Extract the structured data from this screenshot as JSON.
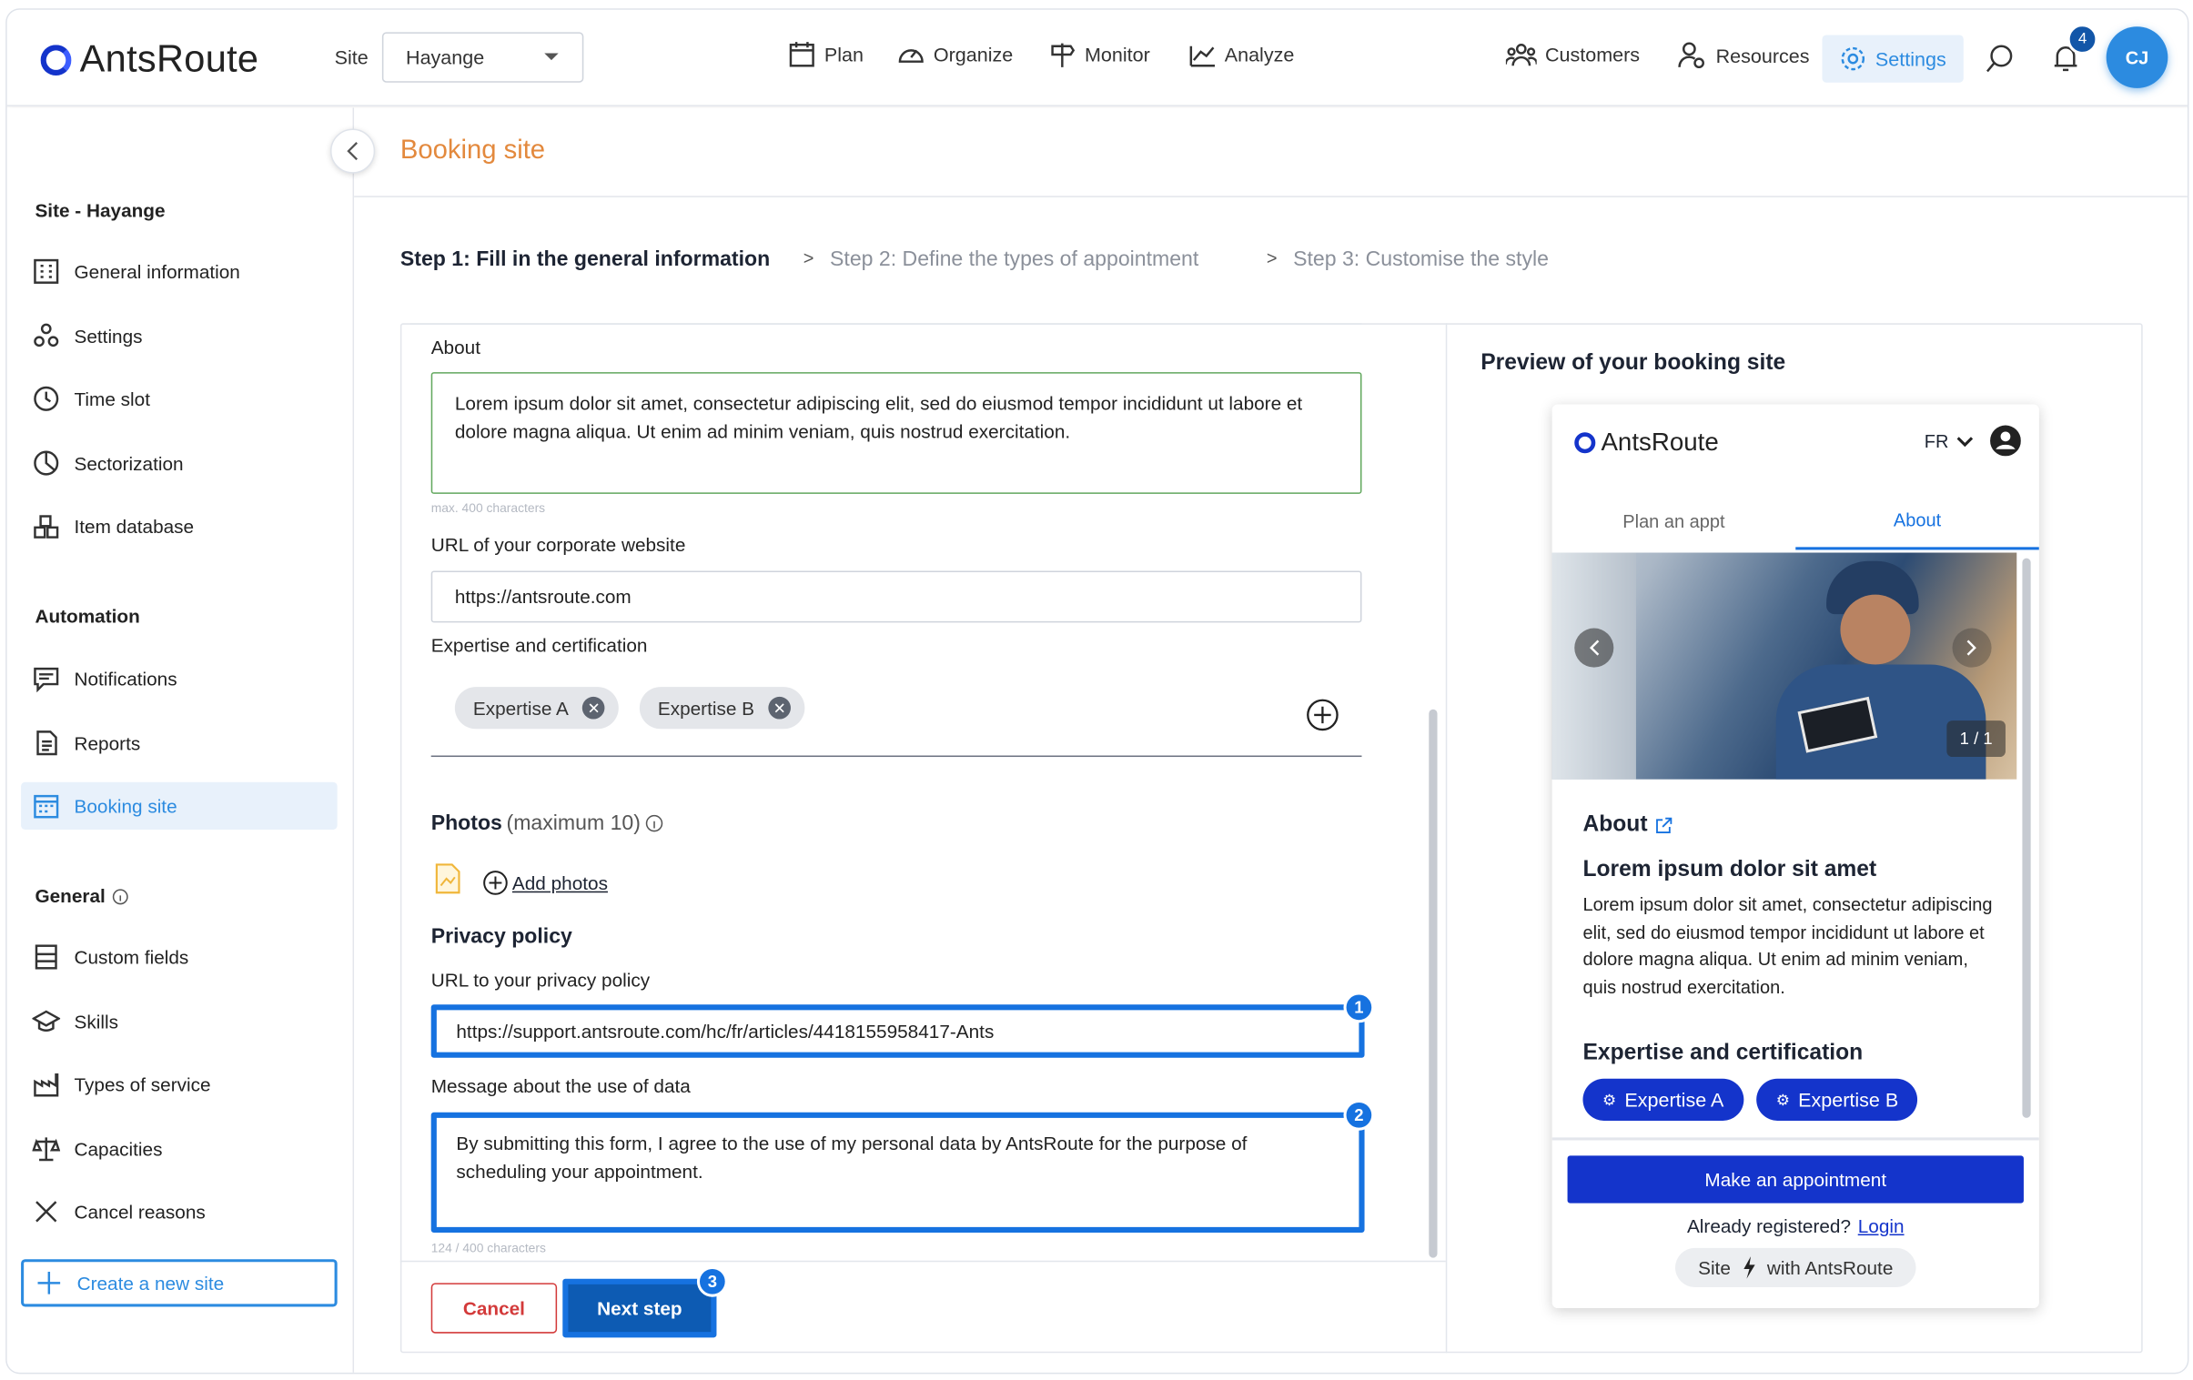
{
  "header": {
    "logo_text": "AntsRoute",
    "site_label": "Site",
    "site_value": "Hayange",
    "nav": [
      {
        "label": "Plan"
      },
      {
        "label": "Organize"
      },
      {
        "label": "Monitor"
      },
      {
        "label": "Analyze"
      }
    ],
    "right_nav": [
      {
        "label": "Customers"
      },
      {
        "label": "Resources"
      },
      {
        "label": "Settings"
      }
    ],
    "notification_count": "4",
    "avatar_initials": "CJ",
    "accent_color": "#1434cb",
    "active_color": "#2c8be0"
  },
  "sidebar": {
    "site_section": "Site - Hayange",
    "site_items": [
      {
        "label": "General information"
      },
      {
        "label": "Settings"
      },
      {
        "label": "Time slot"
      },
      {
        "label": "Sectorization"
      },
      {
        "label": "Item database"
      }
    ],
    "automation_section": "Automation",
    "automation_items": [
      {
        "label": "Notifications"
      },
      {
        "label": "Reports"
      },
      {
        "label": "Booking site"
      }
    ],
    "general_section": "General",
    "general_items": [
      {
        "label": "Custom fields"
      },
      {
        "label": "Skills"
      },
      {
        "label": "Types of service"
      },
      {
        "label": "Capacities"
      },
      {
        "label": "Cancel reasons"
      }
    ],
    "create_site": "Create a new site"
  },
  "page": {
    "title": "Booking site",
    "steps": {
      "step1": "Step 1: Fill in the general information",
      "sep": ">",
      "step2": "Step 2: Define the types of appointment",
      "step3": "Step 3: Customise the style"
    }
  },
  "form": {
    "about_label": "About",
    "about_value": "Lorem ipsum dolor sit amet, consectetur adipiscing elit, sed do eiusmod tempor incididunt ut labore et dolore magna aliqua. Ut enim ad minim veniam, quis nostrud exercitation.",
    "about_hint": "max. 400 characters",
    "website_label": "URL of your corporate website",
    "website_value": "https://antsroute.com",
    "expertise_label": "Expertise and certification",
    "expertise_chips": [
      "Expertise A",
      "Expertise B"
    ],
    "photos_label": "Photos",
    "photos_hint": "(maximum 10)",
    "add_photos": "Add photos",
    "privacy_heading": "Privacy policy",
    "privacy_url_label": "URL to your privacy policy",
    "privacy_url_value": "https://support.antsroute.com/hc/fr/articles/4418155958417-Ants",
    "data_msg_label": "Message about the use of data",
    "data_msg_value": "By submitting this form, I agree to the use of my personal data by AntsRoute for the purpose of scheduling your appointment.",
    "data_msg_hint": "124 / 400 characters",
    "cancel": "Cancel",
    "next": "Next step",
    "markers": [
      "1",
      "2",
      "3"
    ]
  },
  "preview": {
    "title": "Preview of your booking site",
    "logo_text": "AntsRoute",
    "lang": "FR",
    "tab_plan": "Plan an appt",
    "tab_about": "About",
    "photo_counter": "1 / 1",
    "about_heading": "About",
    "content_title": "Lorem ipsum dolor sit amet",
    "content_body": "Lorem ipsum dolor sit amet, consectetur adipiscing elit, sed do eiusmod tempor incididunt ut labore et dolore magna aliqua. Ut enim ad minim veniam, quis nostrud exercitation.",
    "expertise_heading": "Expertise and certification",
    "chips": [
      "Expertise A",
      "Expertise B"
    ],
    "cta": "Make an appointment",
    "registered": "Already registered?",
    "login": "Login",
    "powered_site": "Site",
    "powered_rest": "with AntsRoute"
  }
}
